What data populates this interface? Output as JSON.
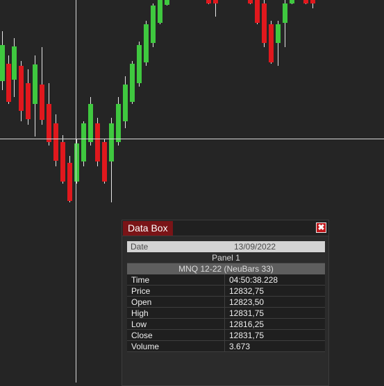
{
  "colors": {
    "up": "#3fc83f",
    "down": "#e0181d",
    "wick": "#e6e6e6",
    "background": "#252525"
  },
  "databox": {
    "title": "Data Box",
    "close_glyph": "✖",
    "date_label": "Date",
    "date_value": "13/09/2022",
    "panel": "Panel 1",
    "series": "MNQ 12-22 (NeuBars 33)",
    "fields": [
      {
        "label": "Time",
        "value": "04:50:38.228"
      },
      {
        "label": "Price",
        "value": "12832,75"
      },
      {
        "label": "Open",
        "value": "12823,50"
      },
      {
        "label": "High",
        "value": "12831,75"
      },
      {
        "label": "Low",
        "value": "12816,25"
      },
      {
        "label": "Close",
        "value": "12831,75"
      },
      {
        "label": "Volume",
        "value": "3.673"
      }
    ]
  }
}
